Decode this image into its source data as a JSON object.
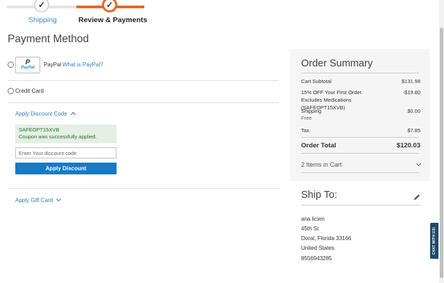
{
  "progress": {
    "steps": [
      {
        "label": "Shipping",
        "status": "done"
      },
      {
        "label": "Review & Payments",
        "status": "active"
      }
    ],
    "check_glyph": "✓"
  },
  "page": {
    "title": "Payment Method"
  },
  "payment": {
    "paypal": {
      "logo_mark": "P",
      "logo_word": "PayPal",
      "label": "PayPal",
      "link": "What is PayPal?"
    },
    "credit_card": {
      "label": "Credit Card"
    }
  },
  "discount": {
    "toggle_label": "Apply Discount Code",
    "applied_code": "SAFEOPT15XVB",
    "success_message": "Coupon was successfully applied.",
    "input_placeholder": "Enter Your discount code",
    "input_value": "",
    "button_label": "Apply Discount"
  },
  "gift_card": {
    "toggle_label": "Apply Gift Card"
  },
  "summary": {
    "title": "Order Summary",
    "cart_subtotal_label": "Cart Subtotal",
    "cart_subtotal_value": "$131.98",
    "discount_label": "15% OFF Your First Order. Excludes Medications (SAFEOPT15XVB)",
    "discount_value": "-$19.80",
    "shipping_label": "Shipping",
    "shipping_sub": "Free",
    "shipping_value": "$0.00",
    "tax_label": "Tax",
    "tax_value": "$7.85",
    "total_label": "Order Total",
    "total_value": "$120.03",
    "items_label": "2 Items in Cart"
  },
  "ship_to": {
    "title": "Ship To:",
    "name": "ana licien",
    "street": "45th St",
    "city_line": "Doral, Florida 33166",
    "country": "United States",
    "phone": "8556943285"
  },
  "chat": {
    "label": "CHAT WITH US!"
  },
  "colors": {
    "accent_orange": "#e86724",
    "primary_blue": "#1979c3",
    "link_blue": "#2d7fb6",
    "success_bg": "#e5efe5",
    "summary_bg": "#f5f5f5"
  }
}
